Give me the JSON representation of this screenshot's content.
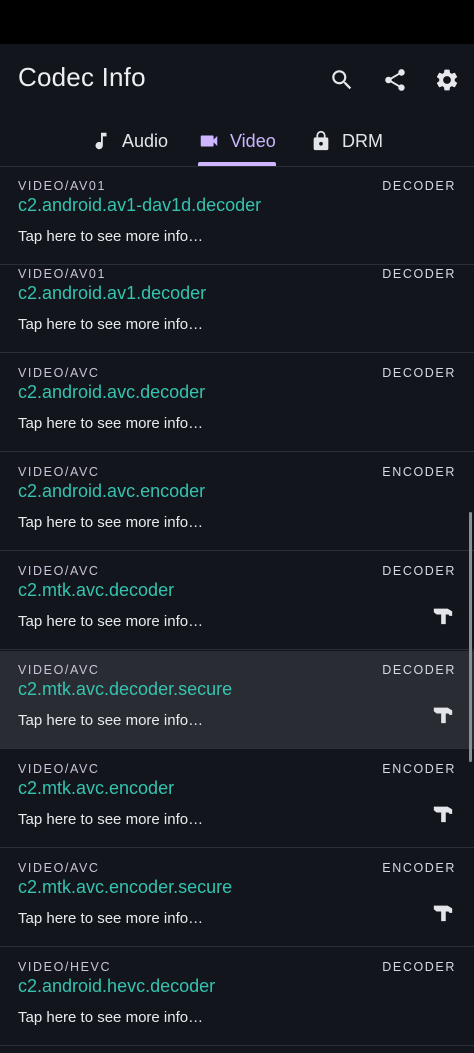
{
  "app": {
    "title": "Codec Info"
  },
  "toolbar": {
    "search_icon": "search-icon",
    "share_icon": "share-icon",
    "settings_icon": "gear-icon"
  },
  "tabs": [
    {
      "label": "Audio",
      "icon": "music-note-icon",
      "selected": false
    },
    {
      "label": "Video",
      "icon": "video-camera-icon",
      "selected": true
    },
    {
      "label": "DRM",
      "icon": "lock-icon",
      "selected": false
    }
  ],
  "colors": {
    "accent": "#cdb5ff",
    "codec_name": "#35c3b0",
    "background": "#12161c",
    "selected_row": "#292d33"
  },
  "codecs": [
    {
      "mime": "VIDEO/AV01",
      "kind": "DECODER",
      "name": "c2.android.av1-dav1d.decoder",
      "hint": "Tap here to see more info…",
      "hardware": false
    },
    {
      "mime": "VIDEO/AV01",
      "kind": "DECODER",
      "name": "c2.android.av1.decoder",
      "hint": "Tap here to see more info…",
      "hardware": false
    },
    {
      "mime": "VIDEO/AVC",
      "kind": "DECODER",
      "name": "c2.android.avc.decoder",
      "hint": "Tap here to see more info…",
      "hardware": false
    },
    {
      "mime": "VIDEO/AVC",
      "kind": "ENCODER",
      "name": "c2.android.avc.encoder",
      "hint": "Tap here to see more info…",
      "hardware": false
    },
    {
      "mime": "VIDEO/AVC",
      "kind": "DECODER",
      "name": "c2.mtk.avc.decoder",
      "hint": "Tap here to see more info…",
      "hardware": true
    },
    {
      "mime": "VIDEO/AVC",
      "kind": "DECODER",
      "name": "c2.mtk.avc.decoder.secure",
      "hint": "Tap here to see more info…",
      "hardware": true
    },
    {
      "mime": "VIDEO/AVC",
      "kind": "ENCODER",
      "name": "c2.mtk.avc.encoder",
      "hint": "Tap here to see more info…",
      "hardware": true
    },
    {
      "mime": "VIDEO/AVC",
      "kind": "ENCODER",
      "name": "c2.mtk.avc.encoder.secure",
      "hint": "Tap here to see more info…",
      "hardware": true
    },
    {
      "mime": "VIDEO/HEVC",
      "kind": "DECODER",
      "name": "c2.android.hevc.decoder",
      "hint": "Tap here to see more info…",
      "hardware": false
    }
  ]
}
